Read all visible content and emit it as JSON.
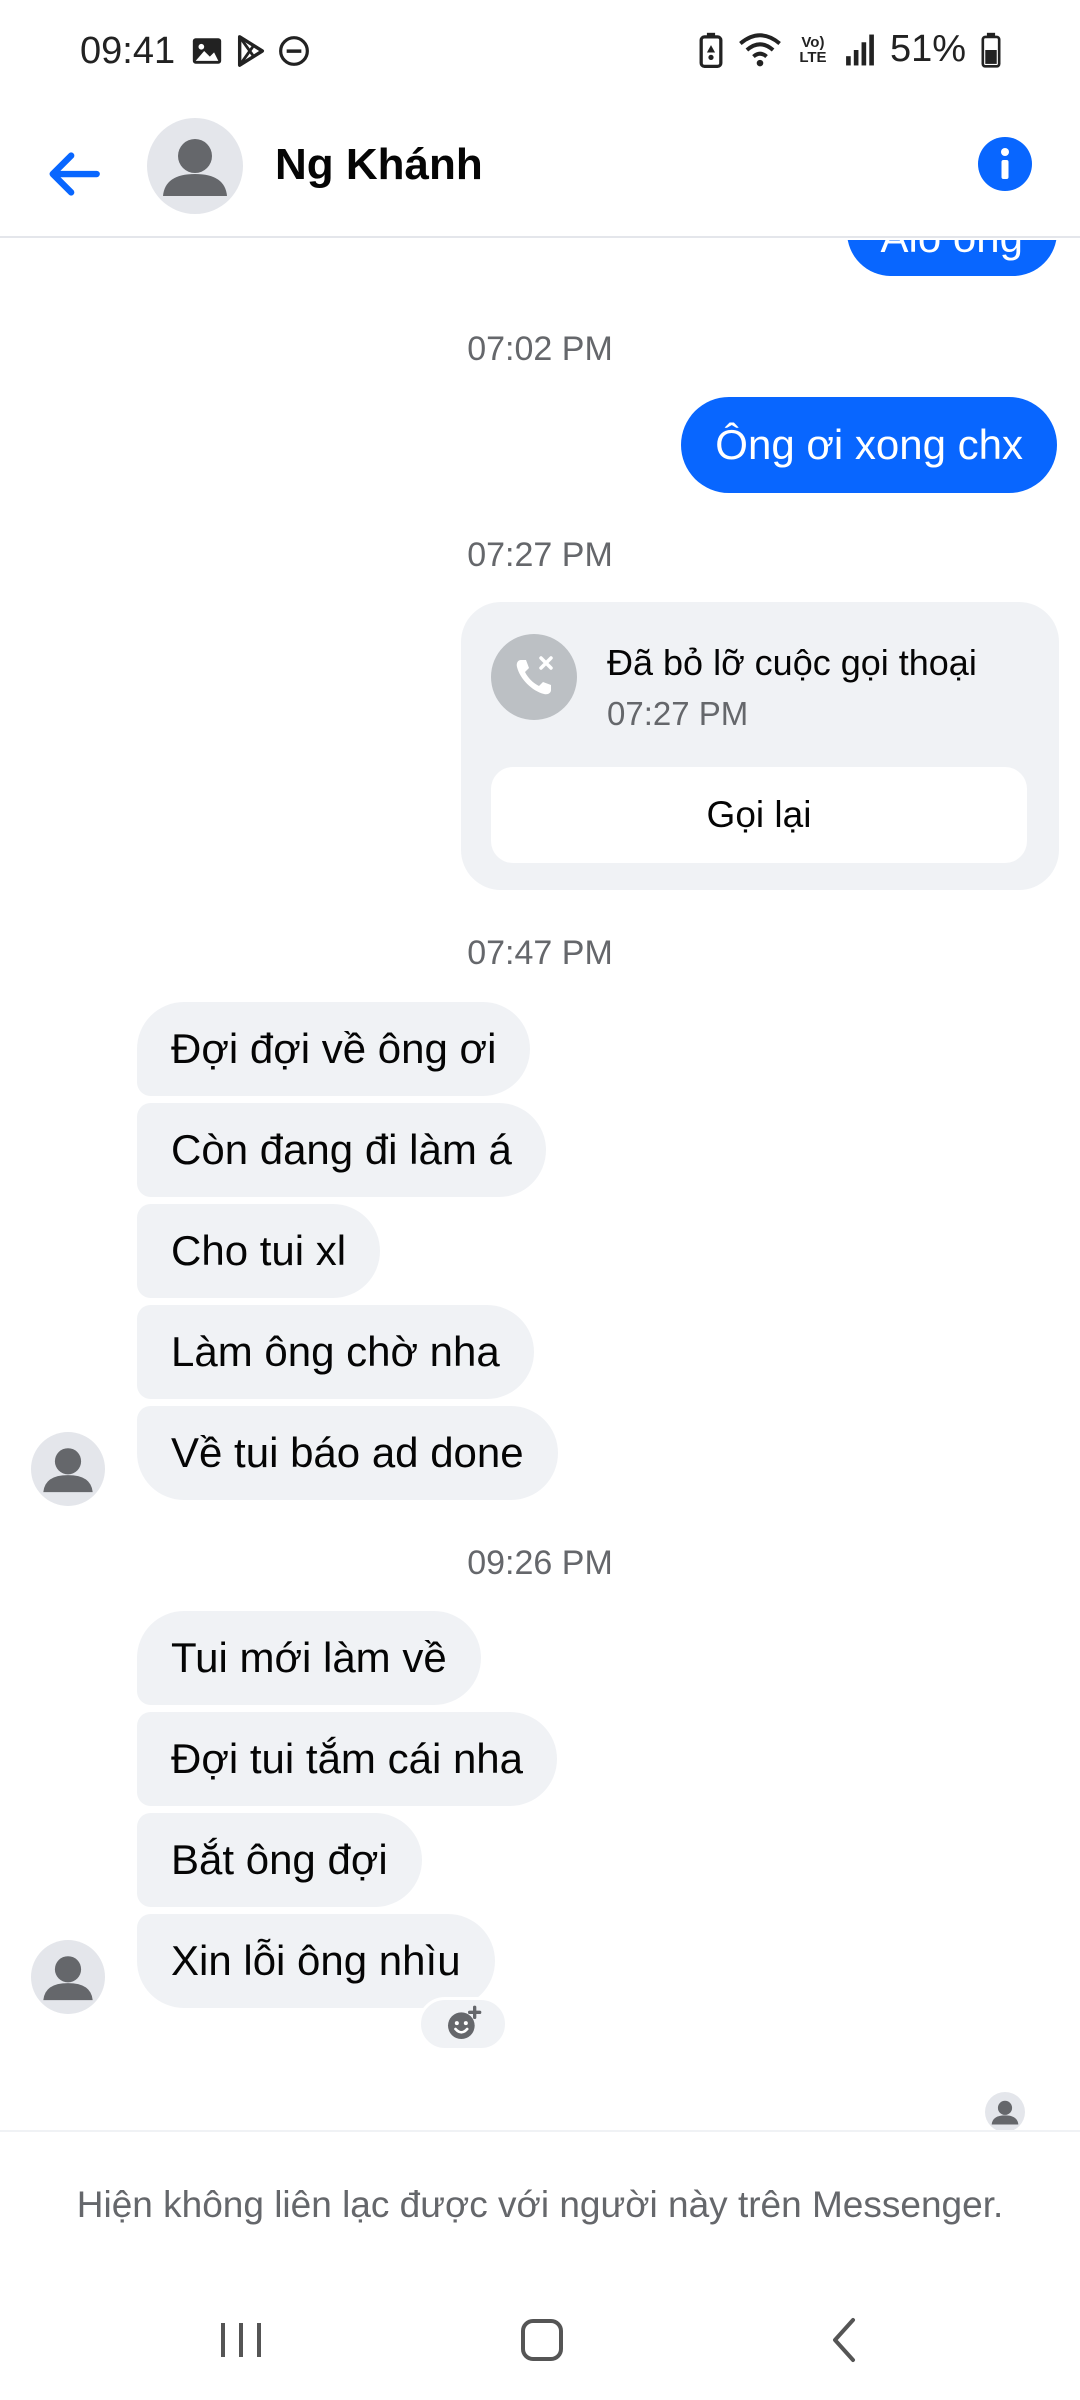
{
  "status_bar": {
    "time": "09:41",
    "battery": "51%",
    "volte": "VoLTE",
    "left_icons": [
      "gallery-icon",
      "play-store-icon",
      "do-not-disturb-icon"
    ],
    "right_icons": [
      "battery-saver-icon",
      "wifi-icon",
      "volte-icon",
      "signal-icon",
      "battery-icon"
    ]
  },
  "header": {
    "contact_name": "Ng Khánh",
    "back_icon": "back-arrow-icon",
    "info_icon": "info-icon"
  },
  "chat": {
    "partial_outgoing": "Alo ông",
    "blocks": [
      {
        "timestamp": "07:02 PM",
        "outgoing": [
          "Ông ơi xong chx"
        ]
      },
      {
        "timestamp": "07:27 PM",
        "missed_call": {
          "title": "Đã bỏ lỡ cuộc gọi thoại",
          "time": "07:27 PM",
          "button": "Gọi lại"
        }
      },
      {
        "timestamp": "07:47 PM",
        "incoming": [
          "Đợi đợi về ông ơi",
          "Còn đang đi làm á",
          "Cho tui xl",
          "Làm ông chờ nha",
          "Về tui báo ad done"
        ]
      },
      {
        "timestamp": "09:26 PM",
        "incoming": [
          "Tui mới làm về",
          "Đợi tui tắm cái nha",
          "Bắt ông đợi",
          "Xin lỗi ông nhìu"
        ]
      }
    ]
  },
  "footer": {
    "notice": "Hiện không liên lạc được với người này trên Messenger."
  },
  "colors": {
    "accent": "#0866ff",
    "incoming_bubble": "#f0f2f5",
    "secondary_text": "#65676b"
  }
}
